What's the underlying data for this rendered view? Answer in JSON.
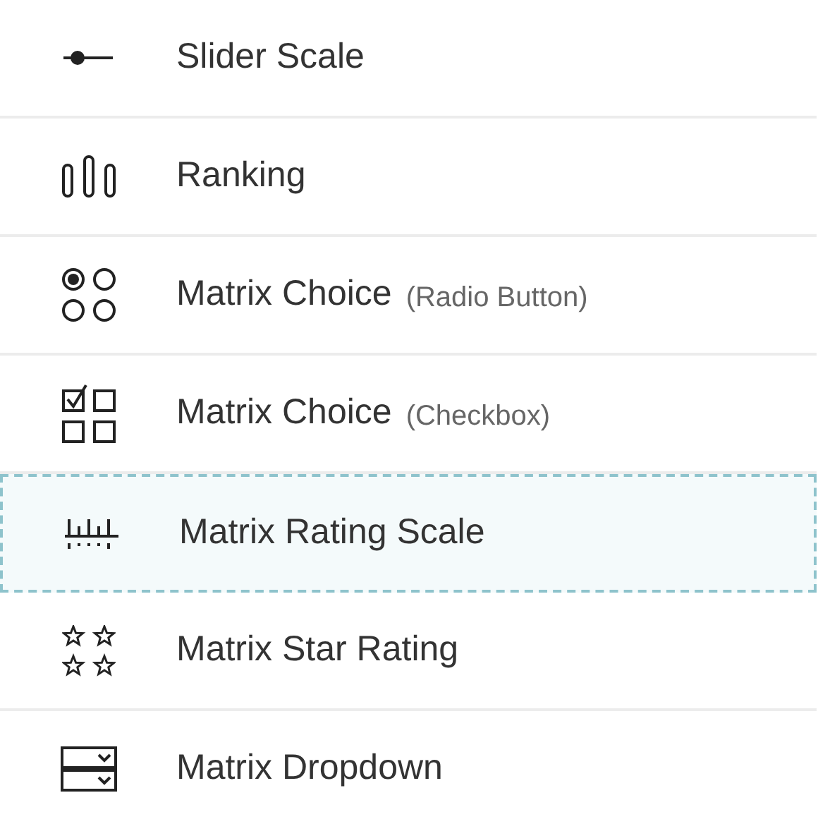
{
  "items": [
    {
      "kind": "slider",
      "label": "Slider Scale",
      "selected": false
    },
    {
      "kind": "ranking",
      "label": "Ranking",
      "selected": false
    },
    {
      "kind": "radio",
      "label": "Matrix Choice",
      "note": "(Radio Button)",
      "selected": false
    },
    {
      "kind": "checkbox",
      "label": "Matrix Choice",
      "note": "(Checkbox)",
      "selected": false
    },
    {
      "kind": "rating",
      "label": "Matrix Rating Scale",
      "selected": true
    },
    {
      "kind": "stars",
      "label": "Matrix Star Rating",
      "selected": false
    },
    {
      "kind": "dropdown",
      "label": "Matrix Dropdown",
      "selected": false
    }
  ]
}
